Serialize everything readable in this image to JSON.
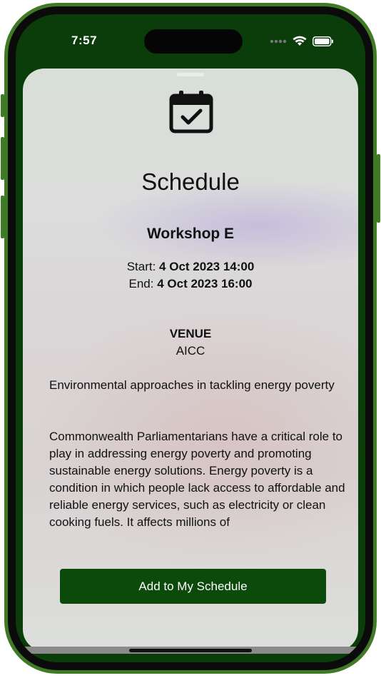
{
  "status_bar": {
    "time": "7:57",
    "icons": [
      "signal-dots-icon",
      "wifi-icon",
      "battery-icon"
    ]
  },
  "sheet": {
    "icon": "calendar-check-icon",
    "title": "Schedule",
    "event_name": "Workshop E",
    "start_label": "Start:",
    "start_value": "4 Oct 2023 14:00",
    "end_label": "End:",
    "end_value": "4 Oct 2023 16:00",
    "venue_label": "VENUE",
    "venue_value": "AICC",
    "summary": "Environmental approaches in tackling energy poverty",
    "description": "Commonwealth Parliamentarians have a critical role to play in addressing energy poverty and promoting sustainable energy solutions. Energy poverty is a condition in which people lack access to affordable and reliable energy services, such as electricity or clean cooking fuels. It affects millions of",
    "add_button_label": "Add to My Schedule"
  },
  "colors": {
    "frame": "#3f7a25",
    "header_green": "#0b3d0b",
    "button_green": "#0c4a0c"
  }
}
